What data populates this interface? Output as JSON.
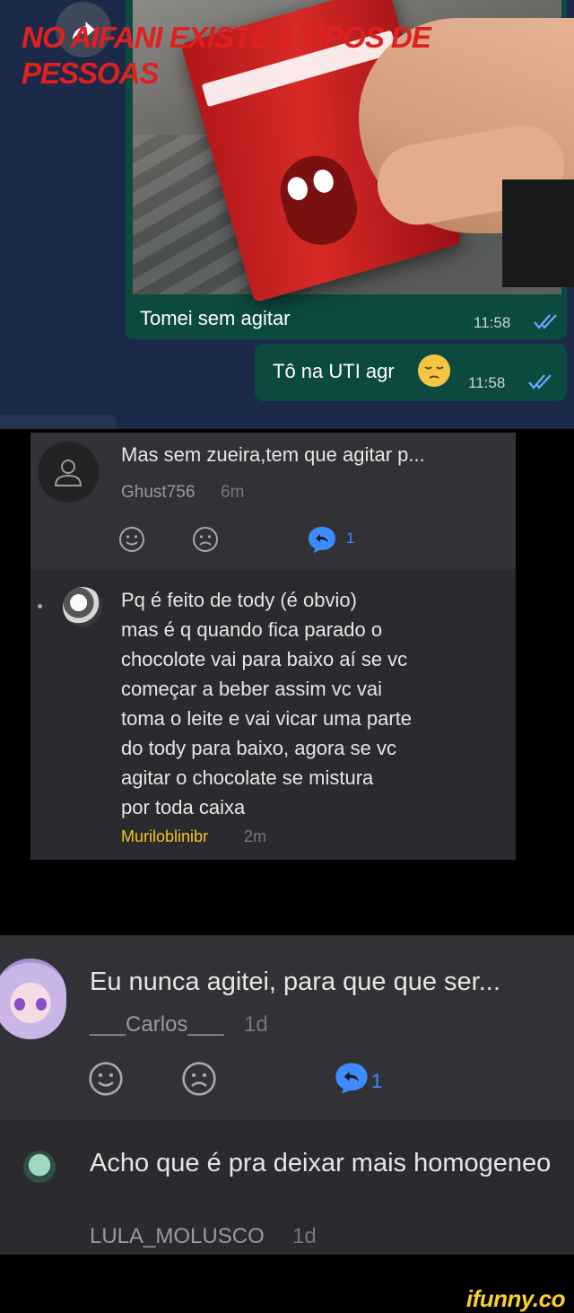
{
  "meme_title": "NO AIFANI EXISTE 2 TIPOS DE PESSOAS",
  "chat": {
    "photo_caption": "Tomei sem agitar",
    "photo_time": "11:58",
    "message_text": "Tô na UTI agr",
    "message_emoji": "pensive-face",
    "message_time": "11:58",
    "read_ticks_color": "#6aa8ff",
    "bubble_color": "#0c4a40",
    "background_color": "#1b2a48"
  },
  "comments_panel_1": {
    "comment": {
      "text": "Mas sem zueira,tem que agitar p...",
      "username": "Ghust756",
      "age": "6m",
      "reply_count": "1"
    },
    "reply": {
      "text": "Pq é feito de tody (é obvio)\nmas é q quando fica parado o\nchocolote vai para baixo aí se vc\ncomeçar a beber assim vc vai\ntoma o leite e vai vicar uma parte\ndo tody para baixo, agora se vc\nagitar o chocolate se mistura\npor toda caixa",
      "username": "Muriloblinibr",
      "username_color": "#f0c419",
      "age": "2m"
    }
  },
  "comments_panel_2": {
    "comment": {
      "text": "Eu nunca agitei, para que que ser...",
      "username": "___Carlos___",
      "age": "1d",
      "reply_count": "1"
    },
    "reply": {
      "text": "Acho que é pra deixar mais homogeneo",
      "username": "LULA_MOLUSCO",
      "age": "1d"
    }
  },
  "reply_accent_color": "#3d8bff",
  "watermark": "ifunny.co"
}
